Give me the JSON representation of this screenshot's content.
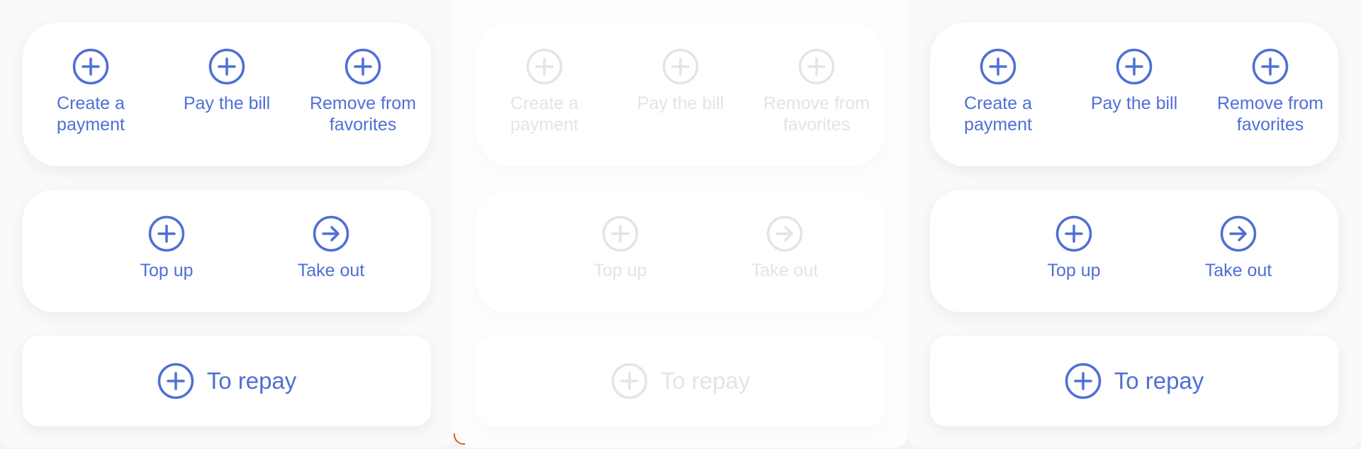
{
  "colors": {
    "accent": "#4f6fd6",
    "disabled": "#e3e4e8",
    "corner_mark": "#e25a1c"
  },
  "panels": [
    {
      "state": "active",
      "quick_actions": [
        {
          "label": "Create a payment",
          "icon": "plus-circle-icon"
        },
        {
          "label": "Pay the bill",
          "icon": "plus-circle-icon"
        },
        {
          "label": "Remove from favorites",
          "icon": "plus-circle-icon"
        }
      ],
      "transfer_actions": [
        {
          "label": "Top up",
          "icon": "plus-circle-icon"
        },
        {
          "label": "Take out",
          "icon": "arrow-right-circle-icon"
        }
      ],
      "repay": {
        "label": "To repay",
        "icon": "plus-circle-icon"
      }
    },
    {
      "state": "disabled",
      "quick_actions": [
        {
          "label": "Create a payment",
          "icon": "plus-circle-icon"
        },
        {
          "label": "Pay the bill",
          "icon": "plus-circle-icon"
        },
        {
          "label": "Remove from favorites",
          "icon": "plus-circle-icon"
        }
      ],
      "transfer_actions": [
        {
          "label": "Top up",
          "icon": "plus-circle-icon"
        },
        {
          "label": "Take out",
          "icon": "arrow-right-circle-icon"
        }
      ],
      "repay": {
        "label": "To repay",
        "icon": "plus-circle-icon"
      }
    },
    {
      "state": "active",
      "quick_actions": [
        {
          "label": "Create a payment",
          "icon": "plus-circle-icon"
        },
        {
          "label": "Pay the bill",
          "icon": "plus-circle-icon"
        },
        {
          "label": "Remove from favorites",
          "icon": "plus-circle-icon"
        }
      ],
      "transfer_actions": [
        {
          "label": "Top up",
          "icon": "plus-circle-icon"
        },
        {
          "label": "Take out",
          "icon": "arrow-right-circle-icon"
        }
      ],
      "repay": {
        "label": "To repay",
        "icon": "plus-circle-icon"
      }
    }
  ]
}
